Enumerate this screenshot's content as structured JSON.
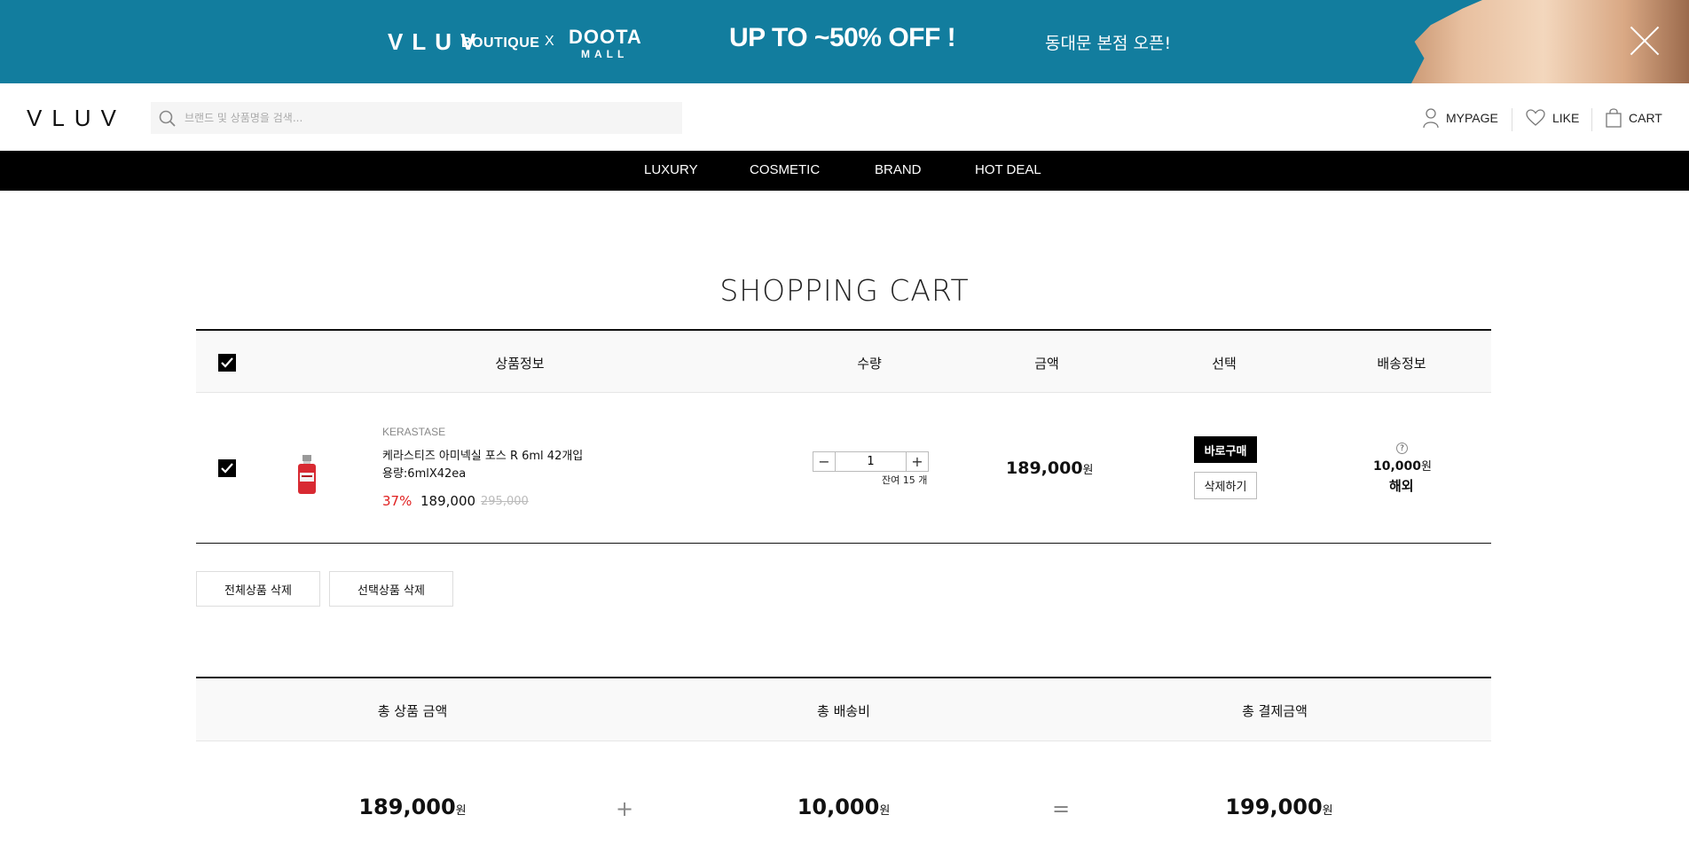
{
  "banner": {
    "brand": "VLUV",
    "brand_suffix": "BOUTIQUE",
    "x": "X",
    "partner_top": "DOOTA",
    "partner_bottom": "MALL",
    "sale_text": "UP TO ~50% OFF !",
    "open_text": "동대문 본점 오픈!",
    "bg_color": "#127d9e"
  },
  "header": {
    "logo": "VLUV",
    "search_placeholder": "브랜드 및 상품명을 검색...",
    "mypage": "MYPAGE",
    "like": "LIKE",
    "cart": "CART"
  },
  "nav": [
    "LUXURY",
    "COSMETIC",
    "BRAND",
    "HOT DEAL"
  ],
  "page_title": "SHOPPING CART",
  "table_headers": {
    "product": "상품정보",
    "quantity": "수량",
    "amount": "금액",
    "select": "선택",
    "shipping": "배송정보"
  },
  "cart_item": {
    "checked": true,
    "brand": "KERASTASE",
    "name": "케라스티즈 아미넥실 포스 R 6ml 42개입",
    "option": "용량:6mlX42ea",
    "discount": "37%",
    "sale_price": "189,000",
    "original_price": "295,000",
    "quantity": "1",
    "stock": "잔여 15 개",
    "amount": "189,000",
    "won": "원",
    "buy_now": "바로구매",
    "delete": "삭제하기",
    "shipping_help": "?",
    "shipping_fee": "10,000",
    "shipping_type": "해외"
  },
  "actions": {
    "delete_all": "전체상품 삭제",
    "delete_selected": "선택상품 삭제"
  },
  "summary": {
    "total_products_label": "총 상품 금액",
    "total_shipping_label": "총 배송비",
    "total_payment_label": "총 결제금액",
    "total_products": "189,000",
    "total_shipping": "10,000",
    "total_payment": "199,000",
    "plus": "+",
    "equals": "=",
    "won": "원"
  }
}
